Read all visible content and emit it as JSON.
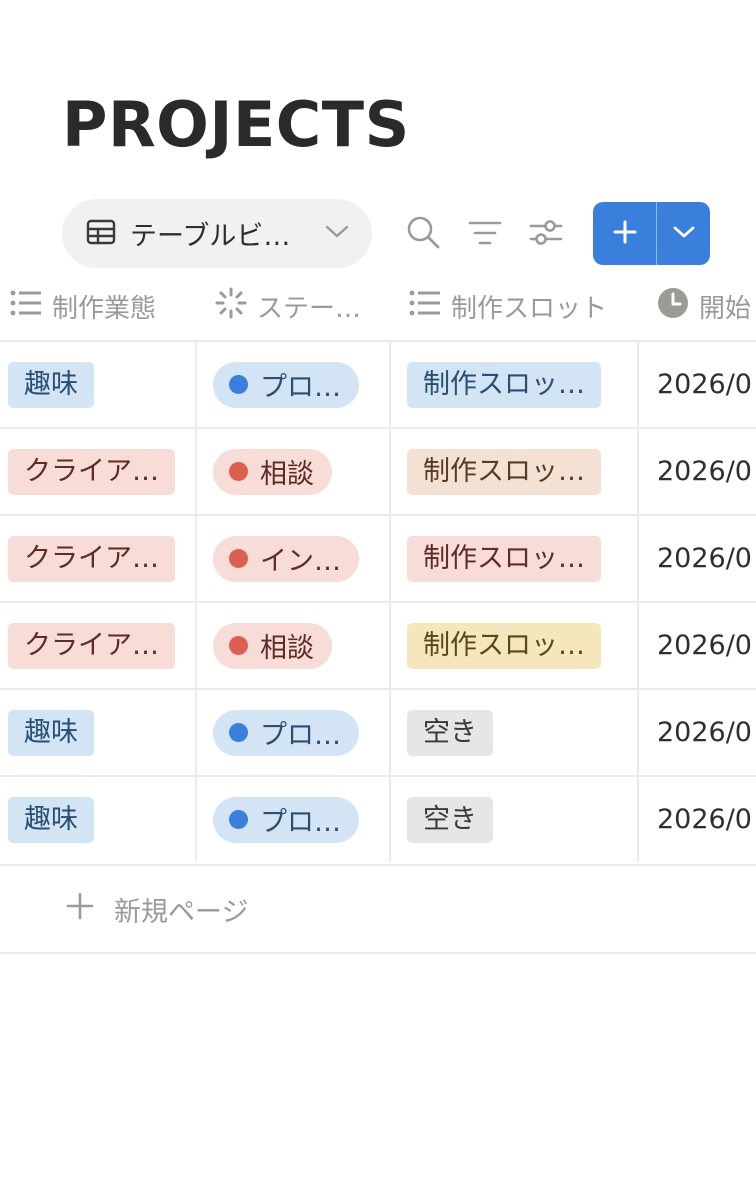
{
  "page": {
    "title": "PROJECTS"
  },
  "toolbar": {
    "view_label": "テーブルビ…",
    "icons": [
      "table-icon",
      "chevron-down-icon",
      "search-icon",
      "filter-icon",
      "settings-sliders-icon",
      "plus-icon",
      "chevron-down-icon"
    ]
  },
  "columns": [
    {
      "label": "制作業態",
      "icon": "list-icon"
    },
    {
      "label": "ステー…",
      "icon": "status-icon"
    },
    {
      "label": "制作スロット",
      "icon": "list-icon"
    },
    {
      "label": "開始",
      "icon": "clock-icon"
    }
  ],
  "rows": [
    {
      "type": "趣味",
      "type_bg": "#d3e5f5",
      "type_fg": "#2b4e73",
      "status": "プロ…",
      "status_bg": "#d3e5f5",
      "status_dot": "#3b7fdc",
      "status_fg": "#2b4e73",
      "slot": "制作スロッ…",
      "slot_bg": "#d3e5f5",
      "slot_fg": "#2b4e73",
      "date": "2026/0"
    },
    {
      "type": "クライア…",
      "type_bg": "#f7dcd8",
      "type_fg": "#5e2c24",
      "status": "相談",
      "status_bg": "#f7dcd8",
      "status_dot": "#dd5f52",
      "status_fg": "#5e2c24",
      "slot": "制作スロッ…",
      "slot_bg": "#f3e2d4",
      "slot_fg": "#5b3a22",
      "date": "2026/0"
    },
    {
      "type": "クライア…",
      "type_bg": "#f7dcd8",
      "type_fg": "#5e2c24",
      "status": "イン…",
      "status_bg": "#f7dcd8",
      "status_dot": "#dd5f52",
      "status_fg": "#5e2c24",
      "slot": "制作スロッ…",
      "slot_bg": "#f7dcd8",
      "slot_fg": "#5e2c24",
      "date": "2026/0"
    },
    {
      "type": "クライア…",
      "type_bg": "#f7dcd8",
      "type_fg": "#5e2c24",
      "status": "相談",
      "status_bg": "#f7dcd8",
      "status_dot": "#dd5f52",
      "status_fg": "#5e2c24",
      "slot": "制作スロッ…",
      "slot_bg": "#f4e6bd",
      "slot_fg": "#5b4716",
      "date": "2026/0"
    },
    {
      "type": "趣味",
      "type_bg": "#d3e5f5",
      "type_fg": "#2b4e73",
      "status": "プロ…",
      "status_bg": "#d3e5f5",
      "status_dot": "#3b7fdc",
      "status_fg": "#2b4e73",
      "slot": "空き",
      "slot_bg": "#e6e6e5",
      "slot_fg": "#3a3a3a",
      "date": "2026/0"
    },
    {
      "type": "趣味",
      "type_bg": "#d3e5f5",
      "type_fg": "#2b4e73",
      "status": "プロ…",
      "status_bg": "#d3e5f5",
      "status_dot": "#3b7fdc",
      "status_fg": "#2b4e73",
      "slot": "空き",
      "slot_bg": "#e6e6e5",
      "slot_fg": "#3a3a3a",
      "date": "2026/0"
    }
  ],
  "new_page_label": "新規ページ"
}
